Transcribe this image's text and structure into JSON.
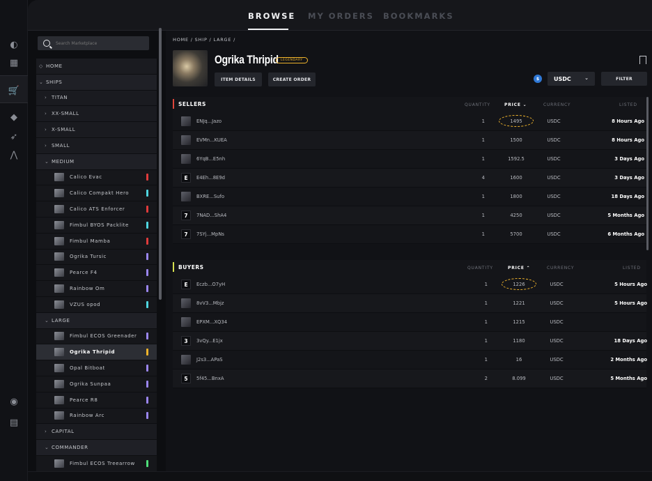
{
  "nav": {
    "tabs": [
      "BROWSE",
      "MY ORDERS",
      "BOOKMARKS"
    ]
  },
  "search": {
    "placeholder": "Search Marketplace"
  },
  "sidebar": {
    "home": "HOME",
    "ships": "SHIPS",
    "titan": "TITAN",
    "xxsmall": "XX-SMALL",
    "xsmall": "X-SMALL",
    "small": "SMALL",
    "medium": "MEDIUM",
    "medium_items": [
      {
        "label": "Calico Evac",
        "color": "#e03b3b"
      },
      {
        "label": "Calico Compakt Hero",
        "color": "#4fd6e0"
      },
      {
        "label": "Calico ATS Enforcer",
        "color": "#e03b3b"
      },
      {
        "label": "Fimbul BYOS Packlite",
        "color": "#4fd6e0"
      },
      {
        "label": "Fimbul Mamba",
        "color": "#e03b3b"
      },
      {
        "label": "Ogrika Tursic",
        "color": "#9b86f0"
      },
      {
        "label": "Pearce F4",
        "color": "#9b86f0"
      },
      {
        "label": "Rainbow Om",
        "color": "#9b86f0"
      },
      {
        "label": "VZUS opod",
        "color": "#4fd6e0"
      }
    ],
    "large": "LARGE",
    "large_items": [
      {
        "label": "Fimbul ECOS Greenader",
        "color": "#9b86f0"
      },
      {
        "label": "Ogrika Thripid",
        "color": "#f0b42c"
      },
      {
        "label": "Opal Bitboat",
        "color": "#9b86f0"
      },
      {
        "label": "Ogrika Sunpaa",
        "color": "#9b86f0"
      },
      {
        "label": "Pearce R8",
        "color": "#9b86f0"
      },
      {
        "label": "Rainbow Arc",
        "color": "#9b86f0"
      }
    ],
    "capital": "CAPITAL",
    "commander": "COMMANDER",
    "commander_items": [
      {
        "label": "Fimbul ECOS Treearrow",
        "color": "#4fe07a"
      }
    ]
  },
  "breadcrumb": "HOME / SHIP / LARGE /",
  "item": {
    "title": "Ogrika Thripid",
    "rarity": "LEGENDARY",
    "details_button": "ITEM DETAILS",
    "create_order_button": "CREATE ORDER"
  },
  "currency": {
    "selected": "USDC"
  },
  "filter_button": "FILTER",
  "columns": {
    "quantity": "QUANTITY",
    "price_sellers": "PRICE",
    "price_buyers": "PRICE",
    "currency": "CURRENCY",
    "listed": "LISTED"
  },
  "sellers": {
    "title": "SELLERS",
    "rows": [
      {
        "avatar": "",
        "name": "ENJq...Jazo",
        "qty": "1",
        "price": "1495",
        "cur": "USDC",
        "listed": "8 Hours Ago"
      },
      {
        "avatar": "",
        "name": "EVMn...KUEA",
        "qty": "1",
        "price": "1500",
        "cur": "USDC",
        "listed": "8 Hours Ago"
      },
      {
        "avatar": "",
        "name": "6YqB...E5nh",
        "qty": "1",
        "price": "1592.5",
        "cur": "USDC",
        "listed": "3 Days Ago"
      },
      {
        "avatar": "E",
        "name": "E4Eh...8E9d",
        "qty": "4",
        "price": "1600",
        "cur": "USDC",
        "listed": "3 Days Ago"
      },
      {
        "avatar": "",
        "name": "BXRE...Sufo",
        "qty": "1",
        "price": "1800",
        "cur": "USDC",
        "listed": "18 Days Ago"
      },
      {
        "avatar": "7",
        "name": "7NAD...ShA4",
        "qty": "1",
        "price": "4250",
        "cur": "USDC",
        "listed": "5 Months Ago"
      },
      {
        "avatar": "7",
        "name": "7SYj...MpNs",
        "qty": "1",
        "price": "5700",
        "cur": "USDC",
        "listed": "6 Months Ago"
      }
    ]
  },
  "buyers": {
    "title": "BUYERS",
    "rows": [
      {
        "avatar": "E",
        "name": "Eczb...O7yH",
        "qty": "1",
        "price": "1226",
        "cur": "USDC",
        "listed": "5 Hours Ago"
      },
      {
        "avatar": "",
        "name": "8vV3...Mbjz",
        "qty": "1",
        "price": "1221",
        "cur": "USDC",
        "listed": "5 Hours Ago"
      },
      {
        "avatar": "",
        "name": "EPXM...XQ34",
        "qty": "1",
        "price": "1215",
        "cur": "USDC",
        "listed": ""
      },
      {
        "avatar": "3",
        "name": "3vQy...E1jx",
        "qty": "1",
        "price": "1180",
        "cur": "USDC",
        "listed": "18 Days Ago"
      },
      {
        "avatar": "",
        "name": "J2s3...APaS",
        "qty": "1",
        "price": "16",
        "cur": "USDC",
        "listed": "2 Months Ago"
      },
      {
        "avatar": "5",
        "name": "5f45...BnxA",
        "qty": "2",
        "price": "8.099",
        "cur": "USDC",
        "listed": "5 Months Ago"
      }
    ]
  },
  "colors": {
    "accent": "#f0b42c",
    "sellers_stripe": "#e0463b",
    "buyers_stripe": "#d6e04f"
  }
}
